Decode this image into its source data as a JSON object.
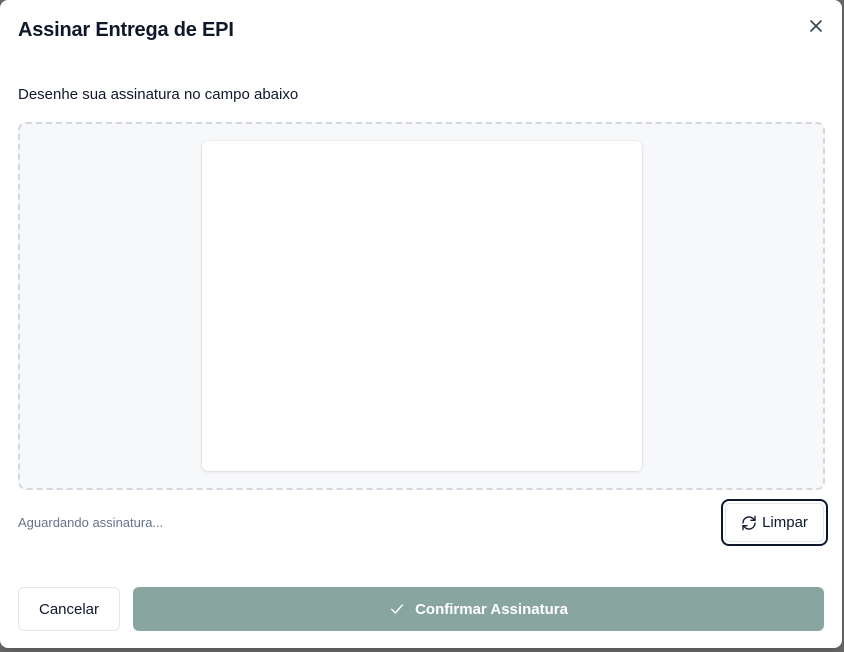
{
  "dialog": {
    "title": "Assinar Entrega de EPI",
    "close_icon": "close-icon"
  },
  "signature": {
    "instruction": "Desenhe sua assinatura no campo abaixo",
    "status": "Aguardando assinatura...",
    "clear_label": "Limpar",
    "clear_icon": "refresh-icon"
  },
  "footer": {
    "cancel_label": "Cancelar",
    "confirm_label": "Confirmar Assinatura",
    "confirm_icon": "check-icon"
  },
  "colors": {
    "confirm_bg": "#88a59f",
    "text": "#0f172a",
    "muted": "#64748b",
    "dashed_border": "#d4d8de"
  }
}
